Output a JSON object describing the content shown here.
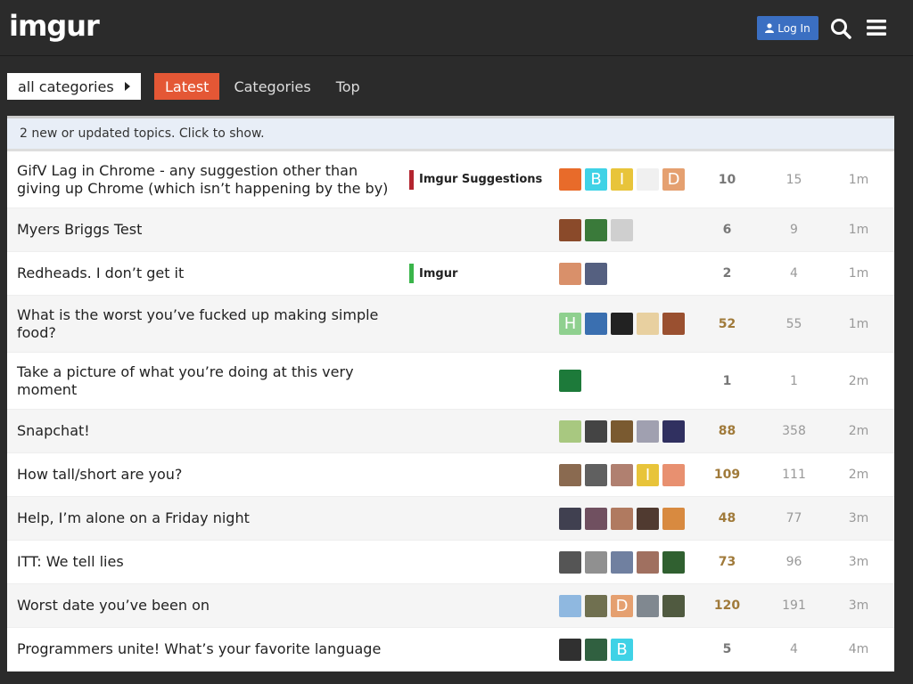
{
  "header": {
    "logo": "imgur",
    "login_label": "Log In"
  },
  "nav": {
    "category_dropdown": "all categories",
    "tabs": [
      {
        "label": "Latest",
        "active": true
      },
      {
        "label": "Categories",
        "active": false
      },
      {
        "label": "Top",
        "active": false
      }
    ]
  },
  "alert": "2 new or updated topics. Click to show.",
  "colors": {
    "accent": "#e45735",
    "login": "#3b6fc2",
    "imgur_suggestions": "#b3252f",
    "imgur": "#3ab54a"
  },
  "topics": [
    {
      "title": "GifV Lag in Chrome - any suggestion other than giving up Chrome (which isn’t happening by the by)",
      "category": "Imgur Suggestions",
      "category_color": "#b3252f",
      "replies": "10",
      "views": "15",
      "activity": "1m",
      "posters": [
        {
          "c": "#e86b2a",
          "t": ""
        },
        {
          "c": "#3fd2e6",
          "t": "B"
        },
        {
          "c": "#e8c43a",
          "t": "I"
        },
        {
          "c": "#f0f0f0",
          "t": ""
        },
        {
          "c": "#e5a070",
          "t": "D"
        }
      ]
    },
    {
      "title": "Myers Briggs Test",
      "category": "",
      "category_color": "",
      "replies": "6",
      "views": "9",
      "activity": "1m",
      "posters": [
        {
          "c": "#8a4a2a",
          "t": ""
        },
        {
          "c": "#3a7a3a",
          "t": ""
        },
        {
          "c": "#cfcfcf",
          "t": ""
        }
      ]
    },
    {
      "title": "Redheads. I don’t get it",
      "category": "Imgur",
      "category_color": "#3ab54a",
      "replies": "2",
      "views": "4",
      "activity": "1m",
      "posters": [
        {
          "c": "#d9906a",
          "t": ""
        },
        {
          "c": "#556080",
          "t": ""
        }
      ]
    },
    {
      "title": "What is the worst you’ve fucked up making simple food?",
      "category": "",
      "category_color": "",
      "replies": "52",
      "views": "55",
      "activity": "1m",
      "posters": [
        {
          "c": "#8fd08f",
          "t": "H"
        },
        {
          "c": "#3a6fb0",
          "t": ""
        },
        {
          "c": "#222222",
          "t": ""
        },
        {
          "c": "#e8d0a0",
          "t": ""
        },
        {
          "c": "#9a5030",
          "t": ""
        }
      ]
    },
    {
      "title": "Take a picture of what you’re doing at this very moment",
      "category": "",
      "category_color": "",
      "replies": "1",
      "views": "1",
      "activity": "2m",
      "posters": [
        {
          "c": "#1d7a3a",
          "t": ""
        }
      ]
    },
    {
      "title": "Snapchat!",
      "category": "",
      "category_color": "",
      "replies": "88",
      "views": "358",
      "activity": "2m",
      "posters": [
        {
          "c": "#a8c880",
          "t": ""
        },
        {
          "c": "#444444",
          "t": ""
        },
        {
          "c": "#7a5a30",
          "t": ""
        },
        {
          "c": "#a0a0b0",
          "t": ""
        },
        {
          "c": "#303060",
          "t": ""
        }
      ]
    },
    {
      "title": "How tall/short are you?",
      "category": "",
      "category_color": "",
      "replies": "109",
      "views": "111",
      "activity": "2m",
      "posters": [
        {
          "c": "#8a6a50",
          "t": ""
        },
        {
          "c": "#606060",
          "t": ""
        },
        {
          "c": "#b08070",
          "t": ""
        },
        {
          "c": "#e8c43a",
          "t": "I"
        },
        {
          "c": "#e89070",
          "t": ""
        }
      ]
    },
    {
      "title": "Help, I’m alone on a Friday night",
      "category": "",
      "category_color": "",
      "replies": "48",
      "views": "77",
      "activity": "3m",
      "posters": [
        {
          "c": "#404050",
          "t": ""
        },
        {
          "c": "#705060",
          "t": ""
        },
        {
          "c": "#b07a60",
          "t": ""
        },
        {
          "c": "#503a30",
          "t": ""
        },
        {
          "c": "#d88a40",
          "t": ""
        }
      ]
    },
    {
      "title": "ITT: We tell lies",
      "category": "",
      "category_color": "",
      "replies": "73",
      "views": "96",
      "activity": "3m",
      "posters": [
        {
          "c": "#555555",
          "t": ""
        },
        {
          "c": "#909090",
          "t": ""
        },
        {
          "c": "#7080a0",
          "t": ""
        },
        {
          "c": "#a07060",
          "t": ""
        },
        {
          "c": "#306030",
          "t": ""
        }
      ]
    },
    {
      "title": "Worst date you’ve been on",
      "category": "",
      "category_color": "",
      "replies": "120",
      "views": "191",
      "activity": "3m",
      "posters": [
        {
          "c": "#8fb8e0",
          "t": ""
        },
        {
          "c": "#707050",
          "t": ""
        },
        {
          "c": "#e5a070",
          "t": "D"
        },
        {
          "c": "#808890",
          "t": ""
        },
        {
          "c": "#505a40",
          "t": ""
        }
      ]
    },
    {
      "title": "Programmers unite! What’s your favorite language",
      "category": "",
      "category_color": "",
      "replies": "5",
      "views": "4",
      "activity": "4m",
      "posters": [
        {
          "c": "#303030",
          "t": ""
        },
        {
          "c": "#306040",
          "t": ""
        },
        {
          "c": "#3fd2e6",
          "t": "B"
        }
      ]
    }
  ]
}
